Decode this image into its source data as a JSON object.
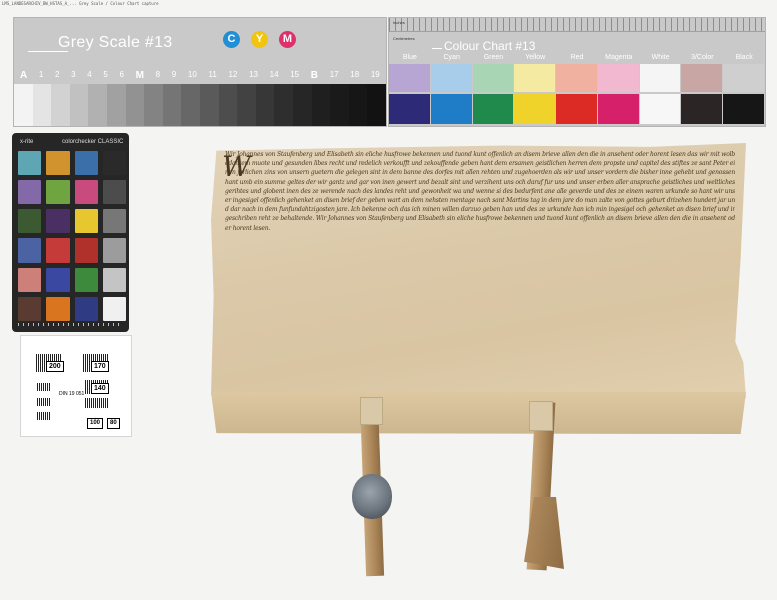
{
  "header_text": "LMS_LANDESARCHIV_BW_HSTAS_A_...  Grey Scale / Colour Chart capture",
  "grey_scale": {
    "title": "Grey Scale #13",
    "cym": [
      "C",
      "Y",
      "M"
    ],
    "steps": [
      "A",
      "1",
      "2",
      "3",
      "4",
      "5",
      "6",
      "M",
      "8",
      "9",
      "10",
      "11",
      "12",
      "13",
      "14",
      "15",
      "B",
      "17",
      "18",
      "19"
    ],
    "patch_colors": [
      "#f3f3f3",
      "#e4e4e4",
      "#d2d2d2",
      "#c1c1c1",
      "#b1b1b1",
      "#a1a1a1",
      "#929292",
      "#838383",
      "#757575",
      "#676767",
      "#5a5a5a",
      "#4d4d4d",
      "#424242",
      "#373737",
      "#2e2e2e",
      "#262626",
      "#1f1f1f",
      "#1a1a1a",
      "#161616",
      "#121212"
    ]
  },
  "colour_chart": {
    "title": "Colour Chart #13",
    "ruler_top": "Inches",
    "ruler_bottom": "Centimetres",
    "names": [
      "Blue",
      "Cyan",
      "Green",
      "Yellow",
      "Red",
      "Magenta",
      "White",
      "3/Color",
      "Black"
    ],
    "row1": [
      "#b7a6d3",
      "#a8cdea",
      "#a8d6b4",
      "#f4eaa2",
      "#f1b1a0",
      "#f2b8cf",
      "#f5f5f5",
      "#c8a6a4",
      "#cfcfcf"
    ],
    "row2": [
      "#2d2a78",
      "#1f7cc6",
      "#1f8a4c",
      "#f0d32a",
      "#dc2b25",
      "#d62069",
      "#f7f7f7",
      "#2b2525",
      "#161616"
    ]
  },
  "colorchecker": {
    "brand": "x-rite",
    "product": "colorchecker CLASSIC",
    "patches": [
      "#5ea6b4",
      "#d0932d",
      "#3b6faa",
      "#2a2a2a",
      "#8469a8",
      "#6fa441",
      "#c94b7d",
      "#4c4c4c",
      "#3b5a31",
      "#4a2f63",
      "#e7c72f",
      "#777777",
      "#4c63a3",
      "#c43b39",
      "#b0302c",
      "#9c9c9c",
      "#cd7f7a",
      "#3a48a2",
      "#3e8a3c",
      "#c4c4c4",
      "#5a3b32",
      "#d9741f",
      "#2f3b83",
      "#f0f0f0"
    ]
  },
  "resolution_target": {
    "labels": [
      "200",
      "170",
      "140",
      "100",
      "80"
    ],
    "caption": "DIN 19 051"
  },
  "document": {
    "initial": "W",
    "text": "Wir Johannes von Staufenberg und Elisabeth sin eliche husfrowe bekennen und tuond kunt offenlich an disem brieve allen den die in ansehent oder horent lesen das wir mit wolbedahtem muote und gesunden libes recht und redelich verkoufft und zekouffende geben hant dem ersamen geistlichen herren dem propste und capitel des stiftes ze sant Peter einen jerlichen zins von unsern guetern die gelegen sint in dem banne des dorfes mit allen rehten und zugehoerden als wir und unser vordern die bisher inne gehebt und genossen hant umb ein summe geltes der wir gantz und gar von inen gewert und bezalt sint und verzihent uns och daruf fur uns und unser erben aller ansprache geistliches und weltliches gerihtes und globent inen des ze werende nach des landes reht und gewonheit wa und wenne si des bedurfent ane alle geverde und des ze einem waren urkunde so hant wir unser ingesigel offenlich gehenket an disen brief der geben wart an dem nehsten mentage nach sant Martins tag in dem jare do man zalte von gottes geburt drizehen hundert jar und dar nach in dem funfundahtzigosten jare. Ich bekenne och das ich minen willen darzuo geben han und des ze urkunde han ich min ingesigel och gehenket an disen brief und ir geschriben reht ze behaltende. Wir Johannes von Staufenberg und Elisabeth sin eliche husfrowe bekennen und tuond kunt offenlich an disem brieve allen den die in ansehent oder horent lesen."
  }
}
